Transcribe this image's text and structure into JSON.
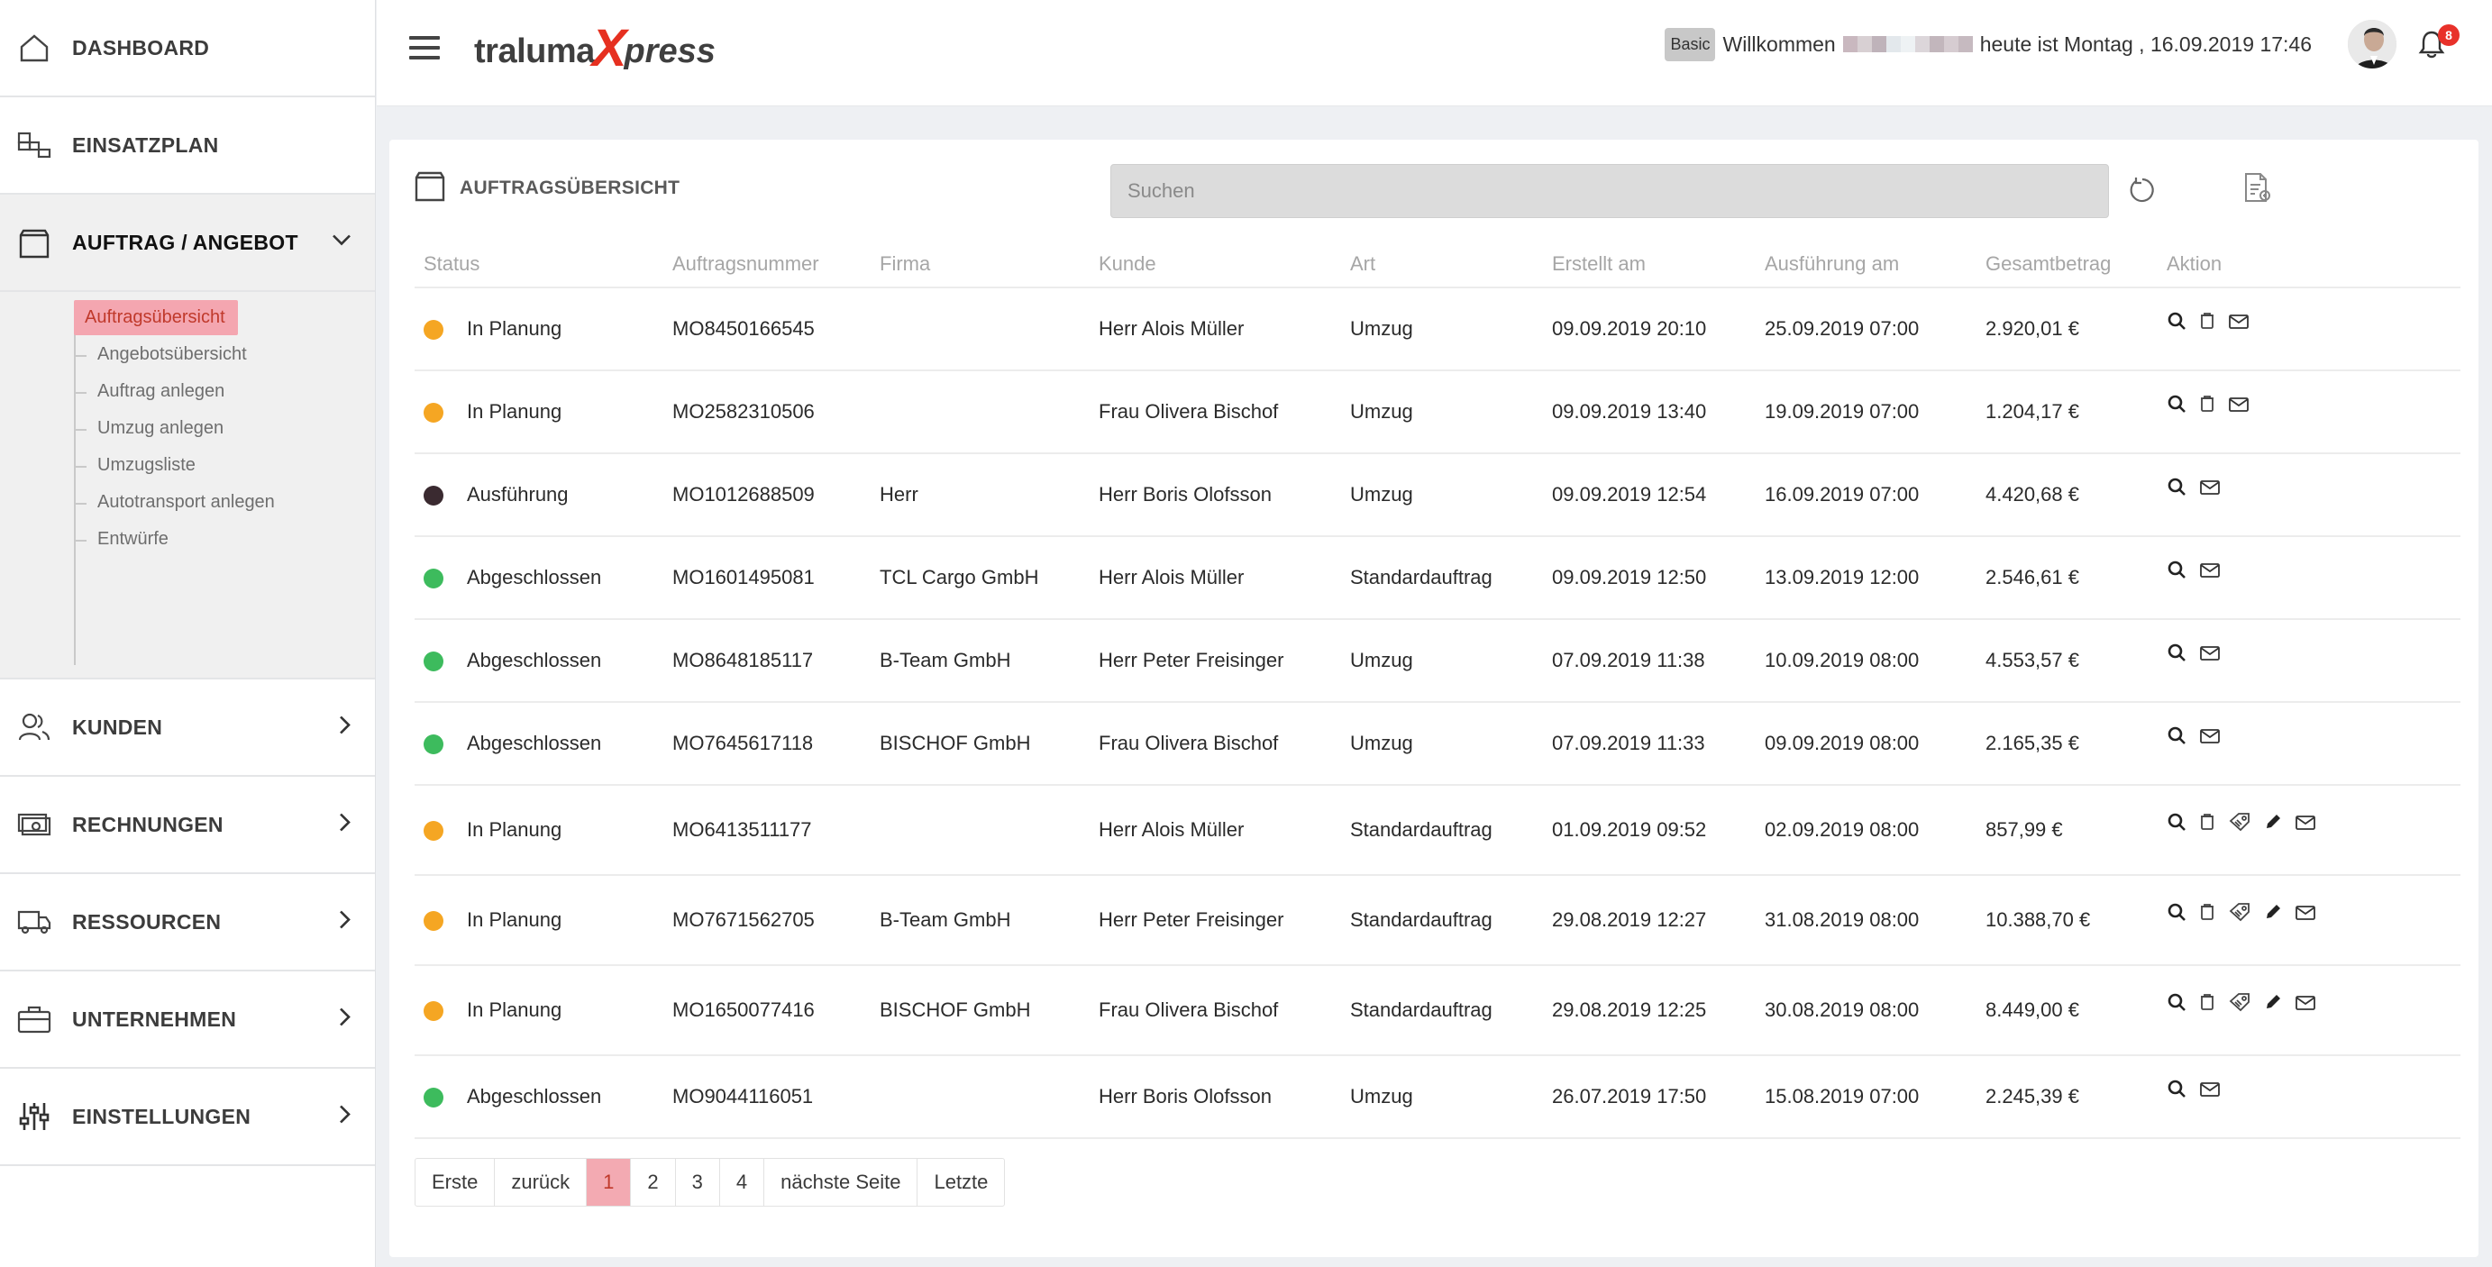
{
  "sidebar": {
    "items": [
      {
        "label": "DASHBOARD",
        "icon": "home-icon"
      },
      {
        "label": "EINSATZPLAN",
        "icon": "plan-icon"
      },
      {
        "label": "AUFTRAG / ANGEBOT",
        "icon": "box-icon",
        "expanded": true
      },
      {
        "label": "KUNDEN",
        "icon": "users-icon"
      },
      {
        "label": "RECHNUNGEN",
        "icon": "money-icon"
      },
      {
        "label": "RESSOURCEN",
        "icon": "truck-icon"
      },
      {
        "label": "UNTERNEHMEN",
        "icon": "briefcase-icon"
      },
      {
        "label": "EINSTELLUNGEN",
        "icon": "sliders-icon"
      }
    ],
    "sub_items": [
      {
        "label": "Auftragsübersicht",
        "selected": true
      },
      {
        "label": "Angebotsübersicht"
      },
      {
        "label": "Auftrag anlegen"
      },
      {
        "label": "Umzug anlegen"
      },
      {
        "label": "Umzugsliste"
      },
      {
        "label": "Autotransport anlegen"
      },
      {
        "label": "Entwürfe"
      }
    ]
  },
  "header": {
    "logo_part1": "traluma",
    "logo_x": "X",
    "logo_part2": "press",
    "plan_badge": "Basic",
    "welcome": "Willkommen",
    "date_text": "heute ist Montag , 16.09.2019 17:46",
    "notification_count": "8"
  },
  "panel": {
    "title": "AUFTRAGSÜBERSICHT",
    "search_placeholder": "Suchen"
  },
  "table": {
    "columns": [
      "Status",
      "Auftragsnummer",
      "Firma",
      "Kunde",
      "Art",
      "Erstellt am",
      "Ausführung am",
      "Gesamtbetrag",
      "Aktion"
    ],
    "rows": [
      {
        "status": "In Planung",
        "status_color": "#f5a623",
        "nr": "MO8450166545",
        "firma": "",
        "kunde": "Herr Alois Müller",
        "art": "Umzug",
        "erstellt": "09.09.2019 20:10",
        "ausfuehrung": "25.09.2019 07:00",
        "betrag": "2.920,01 €",
        "actions": [
          "view",
          "delete",
          "mail"
        ]
      },
      {
        "status": "In Planung",
        "status_color": "#f5a623",
        "nr": "MO2582310506",
        "firma": "",
        "kunde": "Frau Olivera Bischof",
        "art": "Umzug",
        "erstellt": "09.09.2019 13:40",
        "ausfuehrung": "19.09.2019 07:00",
        "betrag": "1.204,17 €",
        "actions": [
          "view",
          "delete",
          "mail"
        ]
      },
      {
        "status": "Ausführung",
        "status_color": "#3a2a30",
        "nr": "MO1012688509",
        "firma": "Herr",
        "kunde": "Herr Boris Olofsson",
        "art": "Umzug",
        "erstellt": "09.09.2019 12:54",
        "ausfuehrung": "16.09.2019 07:00",
        "betrag": "4.420,68 €",
        "actions": [
          "view",
          "mail"
        ]
      },
      {
        "status": "Abgeschlossen",
        "status_color": "#3dbb5d",
        "nr": "MO1601495081",
        "firma": "TCL Cargo GmbH",
        "kunde": "Herr Alois Müller",
        "art": "Standardauftrag",
        "erstellt": "09.09.2019 12:50",
        "ausfuehrung": "13.09.2019 12:00",
        "betrag": "2.546,61 €",
        "actions": [
          "view",
          "mail"
        ]
      },
      {
        "status": "Abgeschlossen",
        "status_color": "#3dbb5d",
        "nr": "MO8648185117",
        "firma": "B-Team GmbH",
        "kunde": "Herr Peter Freisinger",
        "art": "Umzug",
        "erstellt": "07.09.2019 11:38",
        "ausfuehrung": "10.09.2019 08:00",
        "betrag": "4.553,57 €",
        "actions": [
          "view",
          "mail"
        ]
      },
      {
        "status": "Abgeschlossen",
        "status_color": "#3dbb5d",
        "nr": "MO7645617118",
        "firma": "BISCHOF GmbH",
        "kunde": "Frau Olivera Bischof",
        "art": "Umzug",
        "erstellt": "07.09.2019 11:33",
        "ausfuehrung": "09.09.2019 08:00",
        "betrag": "2.165,35 €",
        "actions": [
          "view",
          "mail"
        ]
      },
      {
        "status": "In Planung",
        "status_color": "#f5a623",
        "nr": "MO6413511177",
        "firma": "",
        "kunde": "Herr Alois Müller",
        "art": "Standardauftrag",
        "erstellt": "01.09.2019 09:52",
        "ausfuehrung": "02.09.2019 08:00",
        "betrag": "857,99 €",
        "actions": [
          "view",
          "delete",
          "tag",
          "edit",
          "mail"
        ]
      },
      {
        "status": "In Planung",
        "status_color": "#f5a623",
        "nr": "MO7671562705",
        "firma": "B-Team GmbH",
        "kunde": "Herr Peter Freisinger",
        "art": "Standardauftrag",
        "erstellt": "29.08.2019 12:27",
        "ausfuehrung": "31.08.2019 08:00",
        "betrag": "10.388,70 €",
        "actions": [
          "view",
          "delete",
          "tag",
          "edit",
          "mail"
        ]
      },
      {
        "status": "In Planung",
        "status_color": "#f5a623",
        "nr": "MO1650077416",
        "firma": "BISCHOF GmbH",
        "kunde": "Frau Olivera Bischof",
        "art": "Standardauftrag",
        "erstellt": "29.08.2019 12:25",
        "ausfuehrung": "30.08.2019 08:00",
        "betrag": "8.449,00 €",
        "actions": [
          "view",
          "delete",
          "tag",
          "edit",
          "mail"
        ]
      },
      {
        "status": "Abgeschlossen",
        "status_color": "#3dbb5d",
        "nr": "MO9044116051",
        "firma": "",
        "kunde": "Herr Boris Olofsson",
        "art": "Umzug",
        "erstellt": "26.07.2019 17:50",
        "ausfuehrung": "15.08.2019 07:00",
        "betrag": "2.245,39 €",
        "actions": [
          "view",
          "mail"
        ]
      }
    ]
  },
  "pager": {
    "first": "Erste",
    "prev": "zurück",
    "pages": [
      "1",
      "2",
      "3",
      "4"
    ],
    "current": "1",
    "next": "nächste Seite",
    "last": "Letzte"
  }
}
